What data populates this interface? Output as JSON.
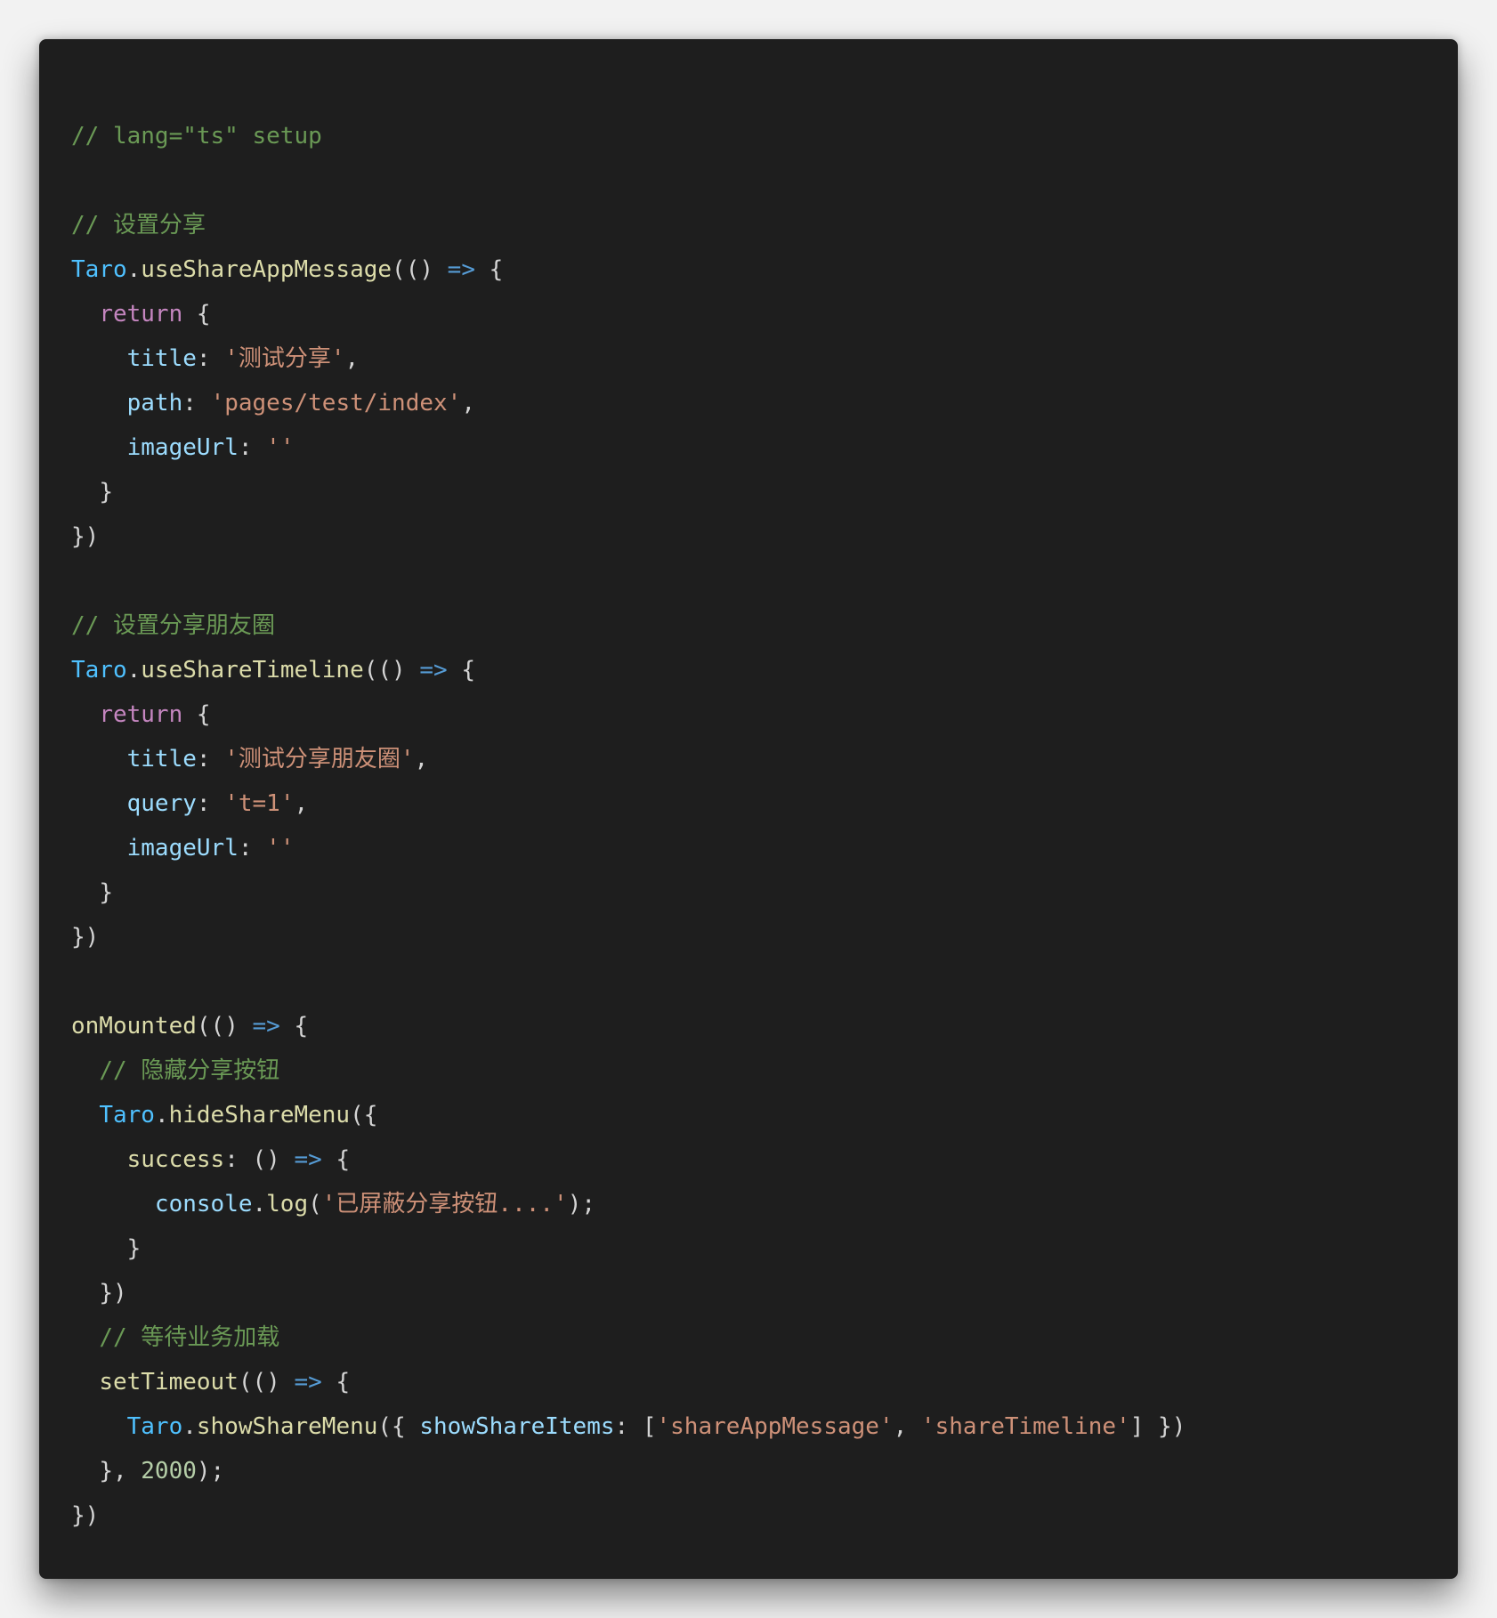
{
  "colors": {
    "page_background": "#f2f2f2",
    "editor_background": "#1e1e1e",
    "comment": "#6a9955",
    "object": "#4fc1ff",
    "function": "#dcdcaa",
    "keyword": "#c586c0",
    "property": "#9cdcfe",
    "string": "#ce9178",
    "arrow": "#569cd6",
    "number": "#b5cea8",
    "punctuation": "#d4d4d4"
  },
  "code": {
    "lines": [
      [
        {
          "t": "comment",
          "v": "// lang=\"ts\" setup"
        }
      ],
      [],
      [
        {
          "t": "comment",
          "v": "// 设置分享"
        }
      ],
      [
        {
          "t": "obj",
          "v": "Taro"
        },
        {
          "t": "punct",
          "v": "."
        },
        {
          "t": "fn",
          "v": "useShareAppMessage"
        },
        {
          "t": "punct",
          "v": "(() "
        },
        {
          "t": "arrow",
          "v": "=>"
        },
        {
          "t": "punct",
          "v": " {"
        }
      ],
      [
        {
          "t": "plain",
          "v": "  "
        },
        {
          "t": "keyword",
          "v": "return"
        },
        {
          "t": "punct",
          "v": " {"
        }
      ],
      [
        {
          "t": "plain",
          "v": "    "
        },
        {
          "t": "prop",
          "v": "title"
        },
        {
          "t": "punct",
          "v": ": "
        },
        {
          "t": "string",
          "v": "'测试分享'"
        },
        {
          "t": "punct",
          "v": ","
        }
      ],
      [
        {
          "t": "plain",
          "v": "    "
        },
        {
          "t": "prop",
          "v": "path"
        },
        {
          "t": "punct",
          "v": ": "
        },
        {
          "t": "string",
          "v": "'pages/test/index'"
        },
        {
          "t": "punct",
          "v": ","
        }
      ],
      [
        {
          "t": "plain",
          "v": "    "
        },
        {
          "t": "prop",
          "v": "imageUrl"
        },
        {
          "t": "punct",
          "v": ": "
        },
        {
          "t": "string",
          "v": "''"
        }
      ],
      [
        {
          "t": "plain",
          "v": "  "
        },
        {
          "t": "punct",
          "v": "}"
        }
      ],
      [
        {
          "t": "punct",
          "v": "})"
        }
      ],
      [],
      [
        {
          "t": "comment",
          "v": "// 设置分享朋友圈"
        }
      ],
      [
        {
          "t": "obj",
          "v": "Taro"
        },
        {
          "t": "punct",
          "v": "."
        },
        {
          "t": "fn",
          "v": "useShareTimeline"
        },
        {
          "t": "punct",
          "v": "(() "
        },
        {
          "t": "arrow",
          "v": "=>"
        },
        {
          "t": "punct",
          "v": " {"
        }
      ],
      [
        {
          "t": "plain",
          "v": "  "
        },
        {
          "t": "keyword",
          "v": "return"
        },
        {
          "t": "punct",
          "v": " {"
        }
      ],
      [
        {
          "t": "plain",
          "v": "    "
        },
        {
          "t": "prop",
          "v": "title"
        },
        {
          "t": "punct",
          "v": ": "
        },
        {
          "t": "string",
          "v": "'测试分享朋友圈'"
        },
        {
          "t": "punct",
          "v": ","
        }
      ],
      [
        {
          "t": "plain",
          "v": "    "
        },
        {
          "t": "prop",
          "v": "query"
        },
        {
          "t": "punct",
          "v": ": "
        },
        {
          "t": "string",
          "v": "'t=1'"
        },
        {
          "t": "punct",
          "v": ","
        }
      ],
      [
        {
          "t": "plain",
          "v": "    "
        },
        {
          "t": "prop",
          "v": "imageUrl"
        },
        {
          "t": "punct",
          "v": ": "
        },
        {
          "t": "string",
          "v": "''"
        }
      ],
      [
        {
          "t": "plain",
          "v": "  "
        },
        {
          "t": "punct",
          "v": "}"
        }
      ],
      [
        {
          "t": "punct",
          "v": "})"
        }
      ],
      [],
      [
        {
          "t": "fn",
          "v": "onMounted"
        },
        {
          "t": "punct",
          "v": "(() "
        },
        {
          "t": "arrow",
          "v": "=>"
        },
        {
          "t": "punct",
          "v": " {"
        }
      ],
      [
        {
          "t": "plain",
          "v": "  "
        },
        {
          "t": "comment",
          "v": "// 隐藏分享按钮"
        }
      ],
      [
        {
          "t": "plain",
          "v": "  "
        },
        {
          "t": "obj",
          "v": "Taro"
        },
        {
          "t": "punct",
          "v": "."
        },
        {
          "t": "fn",
          "v": "hideShareMenu"
        },
        {
          "t": "punct",
          "v": "({"
        }
      ],
      [
        {
          "t": "plain",
          "v": "    "
        },
        {
          "t": "fn",
          "v": "success"
        },
        {
          "t": "punct",
          "v": ": () "
        },
        {
          "t": "arrow",
          "v": "=>"
        },
        {
          "t": "punct",
          "v": " {"
        }
      ],
      [
        {
          "t": "plain",
          "v": "      "
        },
        {
          "t": "prop",
          "v": "console"
        },
        {
          "t": "punct",
          "v": "."
        },
        {
          "t": "fn",
          "v": "log"
        },
        {
          "t": "punct",
          "v": "("
        },
        {
          "t": "string",
          "v": "'已屏蔽分享按钮....'"
        },
        {
          "t": "punct",
          "v": ");"
        }
      ],
      [
        {
          "t": "plain",
          "v": "    "
        },
        {
          "t": "punct",
          "v": "}"
        }
      ],
      [
        {
          "t": "plain",
          "v": "  "
        },
        {
          "t": "punct",
          "v": "})"
        }
      ],
      [
        {
          "t": "plain",
          "v": "  "
        },
        {
          "t": "comment",
          "v": "// 等待业务加载"
        }
      ],
      [
        {
          "t": "plain",
          "v": "  "
        },
        {
          "t": "fn",
          "v": "setTimeout"
        },
        {
          "t": "punct",
          "v": "(() "
        },
        {
          "t": "arrow",
          "v": "=>"
        },
        {
          "t": "punct",
          "v": " {"
        }
      ],
      [
        {
          "t": "plain",
          "v": "    "
        },
        {
          "t": "obj",
          "v": "Taro"
        },
        {
          "t": "punct",
          "v": "."
        },
        {
          "t": "fn",
          "v": "showShareMenu"
        },
        {
          "t": "punct",
          "v": "({ "
        },
        {
          "t": "prop",
          "v": "showShareItems"
        },
        {
          "t": "punct",
          "v": ": ["
        },
        {
          "t": "string",
          "v": "'shareAppMessage'"
        },
        {
          "t": "punct",
          "v": ", "
        },
        {
          "t": "string",
          "v": "'shareTimeline'"
        },
        {
          "t": "punct",
          "v": "] })"
        }
      ],
      [
        {
          "t": "plain",
          "v": "  "
        },
        {
          "t": "punct",
          "v": "}, "
        },
        {
          "t": "number",
          "v": "2000"
        },
        {
          "t": "punct",
          "v": ");"
        }
      ],
      [
        {
          "t": "punct",
          "v": "})"
        }
      ]
    ]
  }
}
